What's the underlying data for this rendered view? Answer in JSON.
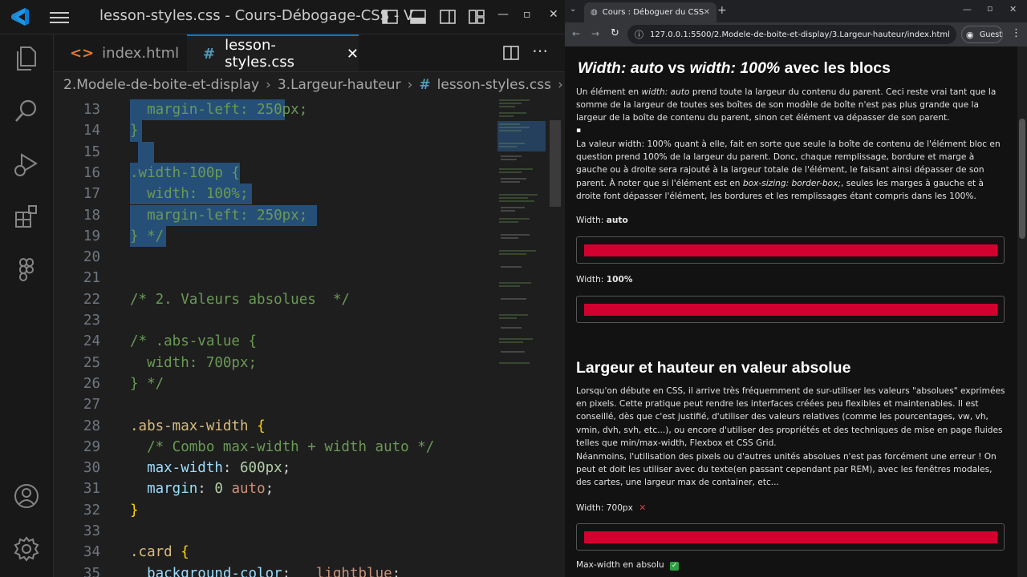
{
  "vscode": {
    "title": "lesson-styles.css - Cours-Débogage-CSS - V...",
    "tabs": [
      {
        "label": "index.html",
        "icon": "html-file-icon",
        "active": false
      },
      {
        "label": "lesson-styles.css",
        "icon": "css-file-icon",
        "active": true
      }
    ],
    "breadcrumb": [
      "2.Modele-de-boite-et-display",
      "3.Largeur-hauteur",
      "lesson-styles.css",
      "..."
    ],
    "lines": [
      {
        "n": "13",
        "text": "  margin-left: 250px;"
      },
      {
        "n": "14",
        "text": "}"
      },
      {
        "n": "15",
        "text": ""
      },
      {
        "n": "16",
        "text": ".width-100p {"
      },
      {
        "n": "17",
        "text": "  width: 100%;"
      },
      {
        "n": "18",
        "text": "  margin-left: 250px;"
      },
      {
        "n": "19",
        "text": "} */"
      },
      {
        "n": "20",
        "text": ""
      },
      {
        "n": "21",
        "text": ""
      },
      {
        "n": "22",
        "text": "/* 2. Valeurs absolues  */"
      },
      {
        "n": "23",
        "text": ""
      },
      {
        "n": "24",
        "text": "/* .abs-value {"
      },
      {
        "n": "25",
        "text": "  width: 700px;"
      },
      {
        "n": "26",
        "text": "} */"
      },
      {
        "n": "27",
        "text": ""
      },
      {
        "n": "28",
        "text": ".abs-max-width {"
      },
      {
        "n": "29",
        "text": "  /* Combo max-width + width auto */"
      },
      {
        "n": "30",
        "text": "  max-width: 600px;"
      },
      {
        "n": "31",
        "text": "  margin: 0 auto;"
      },
      {
        "n": "32",
        "text": "}"
      },
      {
        "n": "33",
        "text": ""
      },
      {
        "n": "34",
        "text": ".card {"
      },
      {
        "n": "35",
        "text": "  background-color:   lightblue;"
      }
    ]
  },
  "browser": {
    "tab_title": "Cours : Déboguer du CSS",
    "url": "127.0.0.1:5500/2.Modele-de-boite-et-display/3.Largeur-hauteur/index.html",
    "profile": "Guest",
    "heading1_a": "Width: auto",
    "heading1_b": " vs ",
    "heading1_c": "width: 100%",
    "heading1_d": " avec les blocs",
    "para1_a": "Un élément en ",
    "para1_b": "width: auto",
    "para1_c": " prend toute la largeur du contenu du parent. Ceci reste vrai tant que la somme de la largeur de toutes ses boîtes de son modèle de boîte n'est pas plus grande que la largeur de la boîte de contenu du parent, sinon cet élément va dépasser de son parent.",
    "bullet": "▪",
    "para2_a": "La valeur width: 100% quant à elle, fait en sorte que seule la boîte de contenu de l'élément bloc en question prend 100% de la largeur du parent. Donc, chaque remplissage, bordure et marge à gauche ou à droite sera rajouté à la largeur totale de l'élément, le faisant ainsi dépasser de son parent. À noter que si l'élément est en ",
    "para2_b": "box-sizing: border-box;",
    "para2_c": ", seules les marges à gauche et à droite font dépasser l'élément, les bordures et les remplissages étant compris dans les 100%.",
    "label1_a": "Width: ",
    "label1_b": "auto",
    "label2_a": "Width: ",
    "label2_b": "100%",
    "heading2": "Largeur et hauteur en valeur absolue",
    "para3": "Lorsqu'on débute en CSS, il arrive très fréquemment de sur-utiliser les valeurs \"absolues\" exprimées en pixels. Cette pratique peut rendre les interfaces créées peu flexibles et maintenables. Il est conseillé, dès que c'est justifié, d'utiliser des valeurs relatives (comme les pourcentages, vw, vh, vmin, dvh, svh, etc...), ou encore d'utiliser des propriétés et des techniques de mise en page fluides telles que min/max-width, Flexbox et CSS Grid.",
    "para4": "Néanmoins, l'utilisation des pixels ou d'autres unités absolues n'est pas forcément une erreur ! On peut et doit les utiliser avec du texte(en passant cependant par REM), avec les fenêtres modales, des cartes, une largeur max de container, etc...",
    "label3": "Width: 700px",
    "label3_mark": "✕",
    "label4": "Max-width en absolu",
    "label4_mark": "✓"
  },
  "colors": {
    "bar": "#d2002f",
    "accent": "#0078d4",
    "selection": "#264f78"
  }
}
